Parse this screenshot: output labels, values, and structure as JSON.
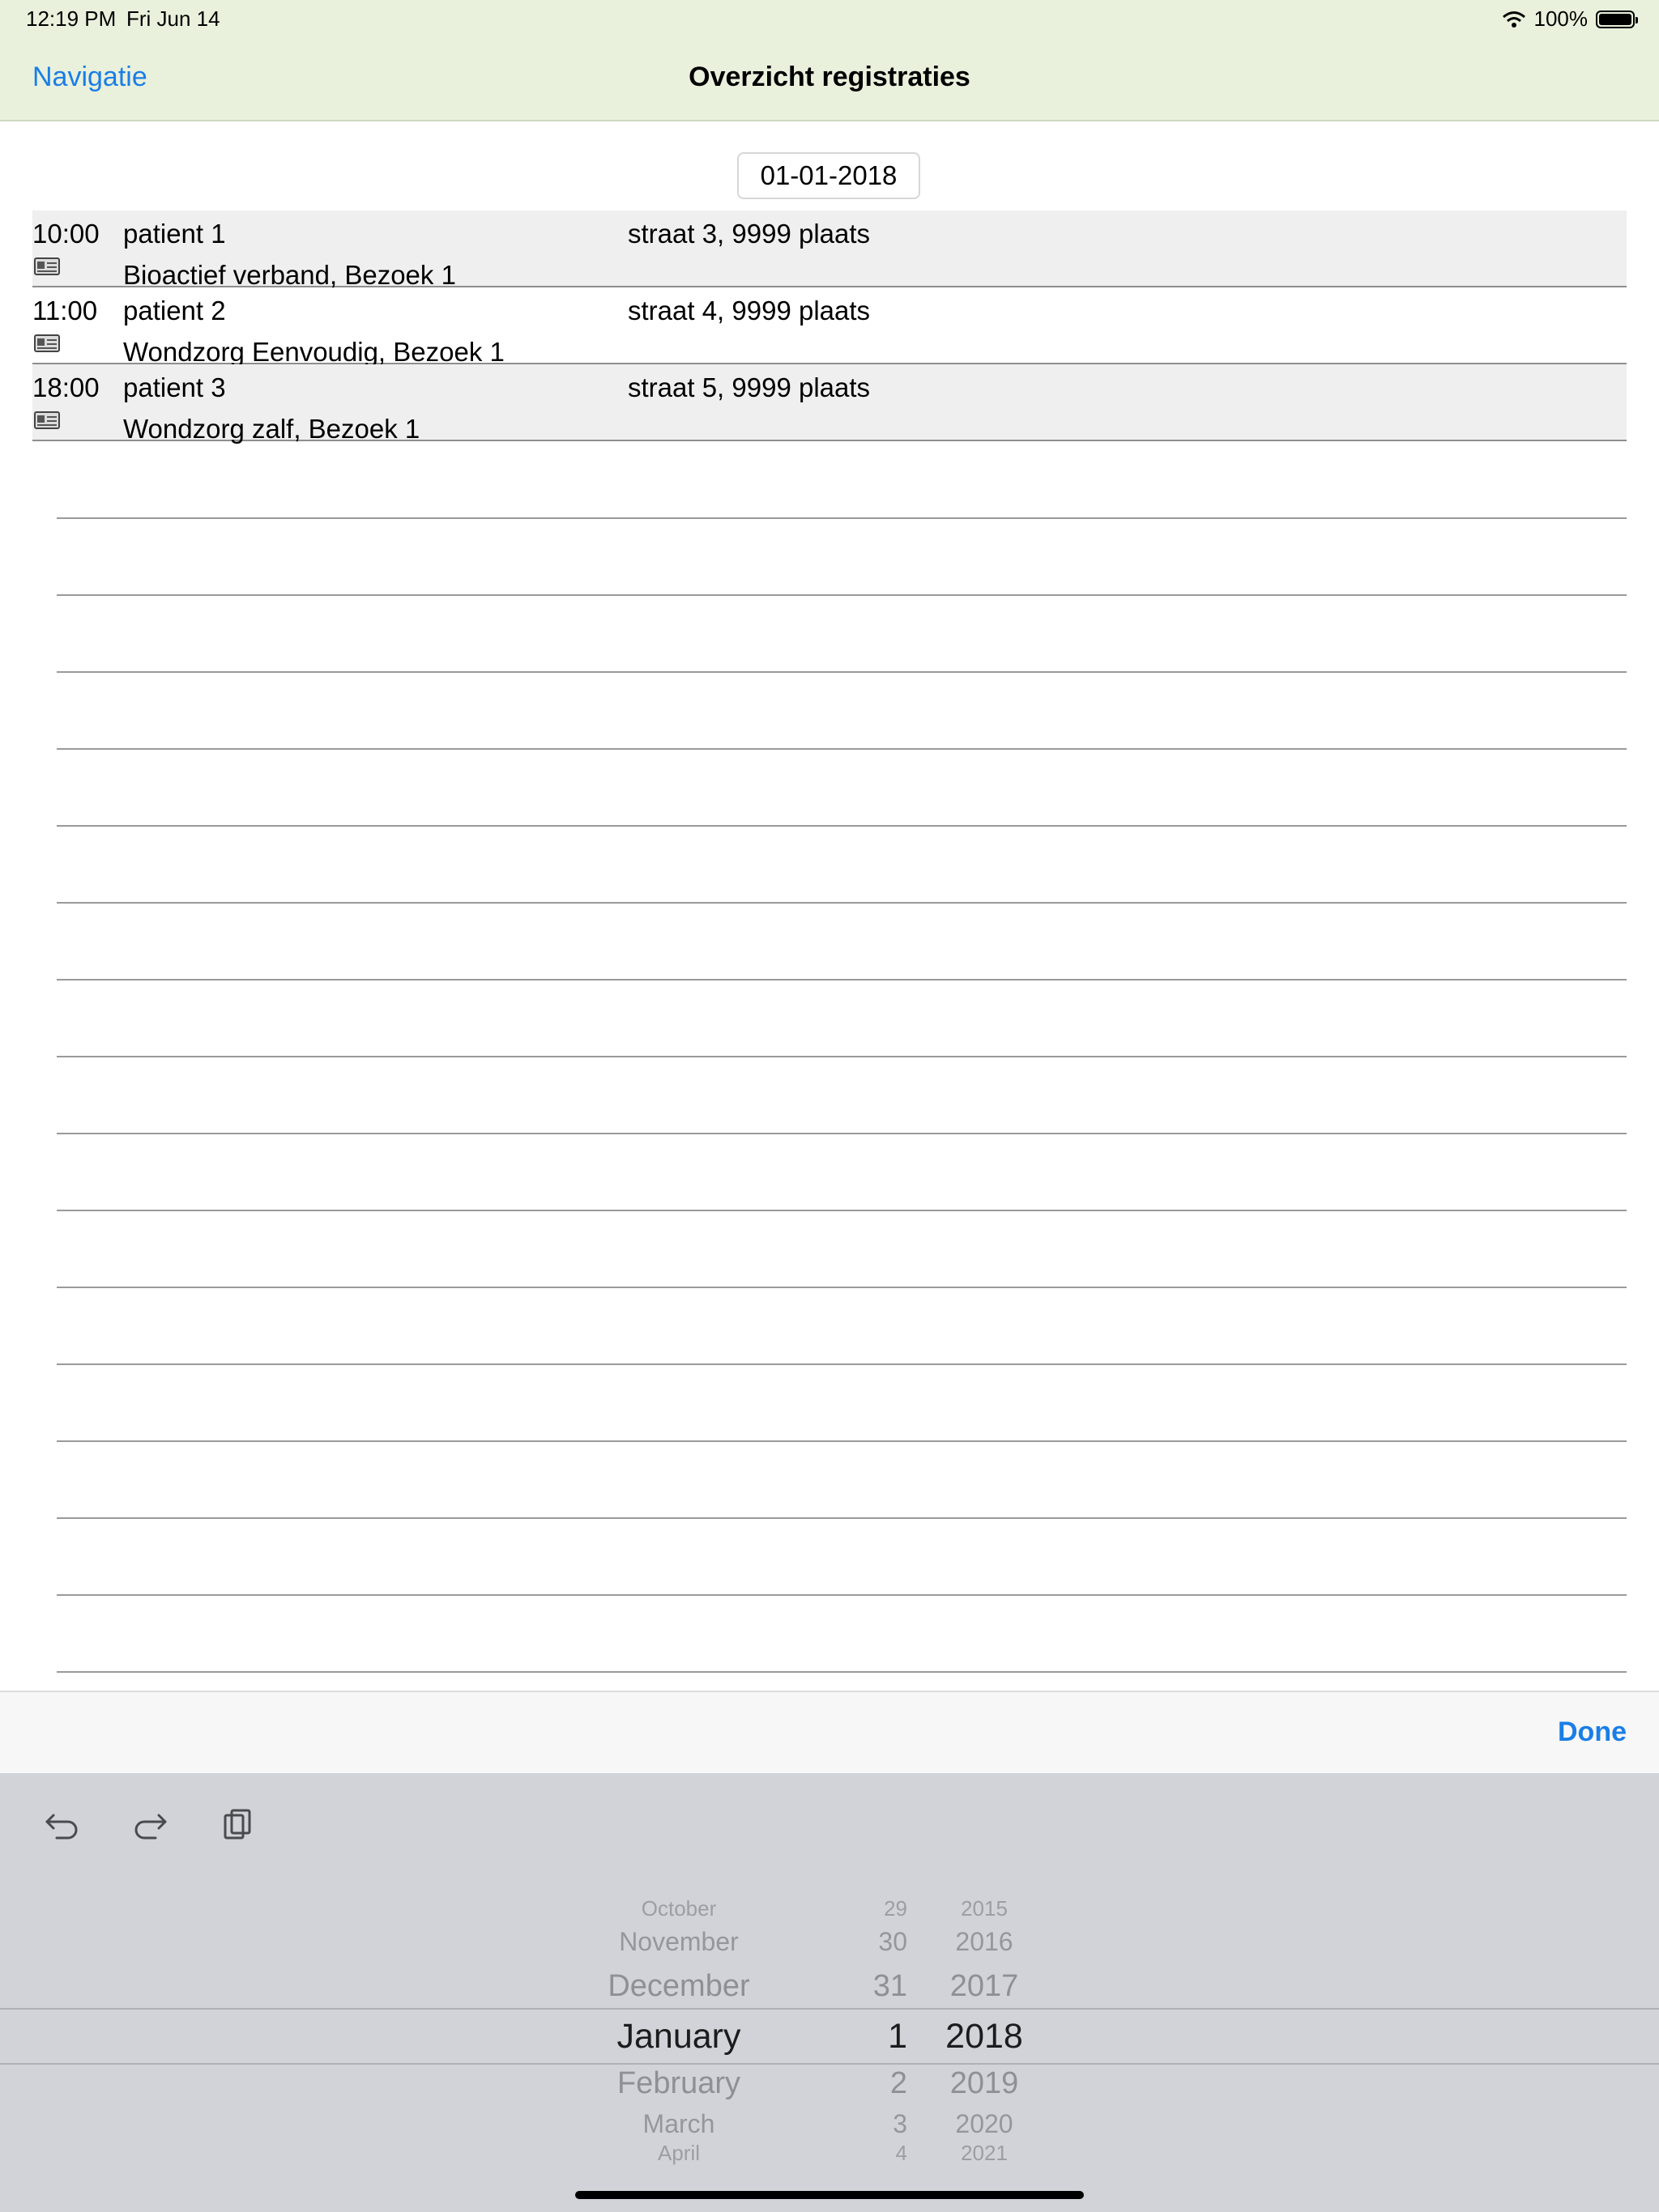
{
  "status_bar": {
    "time": "12:19 PM",
    "date": "Fri Jun 14",
    "battery_text": "100%"
  },
  "nav": {
    "back_label": "Navigatie",
    "title": "Overzicht registraties"
  },
  "date_field": {
    "value": "01-01-2018"
  },
  "registrations": [
    {
      "time": "10:00",
      "name": "patient 1",
      "address": "straat 3, 9999 plaats",
      "description": "Bioactief verband, Bezoek 1",
      "icon": "id-card-icon"
    },
    {
      "time": "11:00",
      "name": "patient 2",
      "address": "straat 4, 9999 plaats",
      "description": "Wondzorg Eenvoudig, Bezoek 1",
      "icon": "id-card-icon"
    },
    {
      "time": "18:00",
      "name": "patient 3",
      "address": "straat 5, 9999 plaats",
      "description": "Wondzorg zalf, Bezoek 1",
      "icon": "id-card-icon"
    }
  ],
  "accessory": {
    "done_label": "Done"
  },
  "toolbar_icons": [
    "undo-icon",
    "redo-icon",
    "paste-icon"
  ],
  "picker": {
    "months": [
      "October",
      "November",
      "December",
      "January",
      "February",
      "March",
      "April"
    ],
    "days": [
      "29",
      "30",
      "31",
      "1",
      "2",
      "3",
      "4"
    ],
    "years": [
      "2015",
      "2016",
      "2017",
      "2018",
      "2019",
      "2020",
      "2021"
    ],
    "selected": {
      "month": "January",
      "day": "1",
      "year": "2018"
    }
  },
  "colors": {
    "nav_background": "#e9f1dc",
    "accent": "#1a7ee6",
    "row_shade": "#efefef",
    "picker_background": "#d1d3d9"
  }
}
